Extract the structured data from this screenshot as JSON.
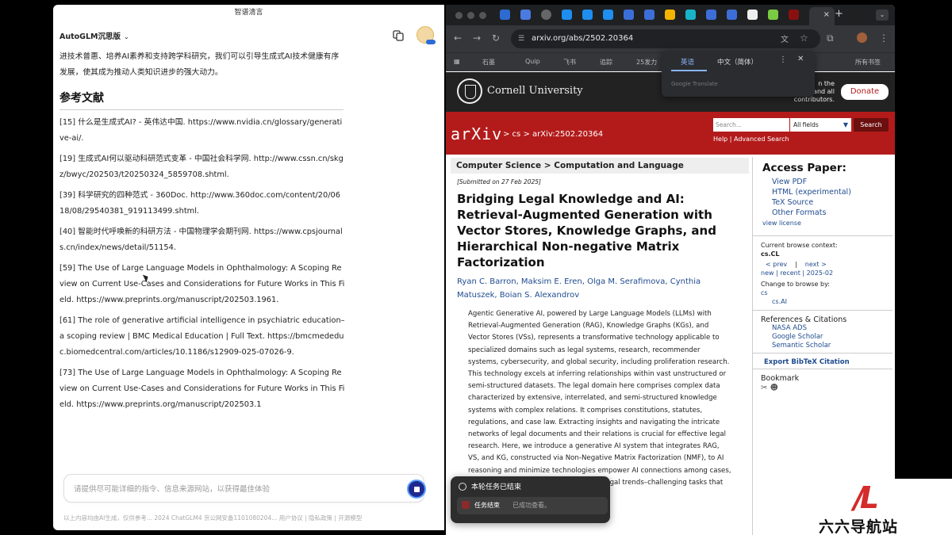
{
  "left": {
    "window_title": "智谱清言",
    "app_name": "AutoGLM沉思版",
    "intro_text": "进技术普惠、培养AI素养和支持跨学科研究，我们可以引导生成式AI技术健康有序发展，使其成为推动人类知识进步的强大动力。",
    "refs_heading": "参考文献",
    "refs": [
      "[15] 什么是生成式AI? - 英伟达中国. https://www.nvidia.cn/glossary/generative-ai/.",
      "[19] 生成式AI何以驱动科研范式变革 - 中国社会科学网. http://www.cssn.cn/skgz/bwyc/202503/t20250324_5859708.shtml.",
      "[39] 科学研究的四种范式 - 360Doc. http://www.360doc.com/content/20/0618/08/29540381_919113499.shtml.",
      "[40] 智能时代呼唤新的科研方法 - 中国物理学会期刊网. https://www.cpsjournals.cn/index/news/detail/51154.",
      "[59] The Use of Large Language Models in Ophthalmology: A Scoping Review on Current Use-Cases and Considerations for Future Works in This Field. https://www.preprints.org/manuscript/202503.1961.",
      "[61] The role of generative artificial intelligence in psychiatric education– a scoping review | BMC Medical Education | Full Text. https://bmcmededuc.biomedcentral.com/articles/10.1186/s12909-025-07026-9.",
      "[73] The Use of Large Language Models in Ophthalmology: A Scoping Review on Current Use-Cases and Considerations for Future Works in This Field. https://www.preprints.org/manuscript/202503.1"
    ],
    "input_placeholder": "请提供尽可能详细的指令、信息来源网站，以获得最佳体验",
    "footer": "以上内容均由AI生成，仅供参考...   2024 ChatGLM4 京公网安备1101080204...   用户协议 | 隐私政策 |   开源模型"
  },
  "browser": {
    "url": "arxiv.org/abs/2502.20364",
    "bookmarks": [
      "石墨",
      "Quip",
      "飞书",
      "追踪",
      "25发力",
      "所有书签"
    ],
    "translate": {
      "lang1": "英语",
      "lang2": "中文（简体）",
      "powered": "Google Translate"
    },
    "tab_close": "×",
    "tab_new": "+"
  },
  "page": {
    "cornell": "Cornell University",
    "thanks": "n the\nand all\ncontributors.",
    "donate": "Donate",
    "arxiv_logo": "arXiv",
    "breadcrumb": "> cs > arXiv:2502.20364",
    "search_placeholder": "Search...",
    "fields": "All fields",
    "search_btn": "Search",
    "help": "Help | Advanced Search",
    "subject": "Computer Science > Computation and Language",
    "submitted": "[Submitted on 27 Feb 2025]",
    "title": "Bridging Legal Knowledge and AI: Retrieval-Augmented Generation with Vector Stores, Knowledge Graphs, and Hierarchical Non-negative Matrix Factorization",
    "authors": "Ryan C. Barron, Maksim E. Eren, Olga M. Serafimova, Cynthia Matuszek, Boian S. Alexandrov",
    "abstract": "Agentic Generative AI, powered by Large Language Models (LLMs) with Retrieval-Augmented Generation (RAG), Knowledge Graphs (KGs), and Vector Stores (VSs), represents a transformative technology applicable to specialized domains such as legal systems, research, recommender systems, cybersecurity, and global security, including proliferation research. This technology excels at inferring relationships within vast unstructured or semi-structured datasets. The legal domain here comprises complex data characterized by extensive, interrelated, and semi-structured knowledge systems with complex relations. It comprises constitutions, statutes, regulations, and case law. Extracting insights and navigating the intricate networks of legal documents and their relations is crucial for effective legal research. Here, we introduce a generative AI system that integrates RAG, VS, and KG, constructed via Non-Negative Matrix Factorization (NMF), to                      AI reasoning and minimize                      technologies empower AI                      connections among cases,                      ing hidden relationships and predicting legal trends–challenging tasks that are essential for",
    "side": {
      "access_head": "Access Paper:",
      "access_links": [
        "View PDF",
        "HTML (experimental)",
        "TeX Source",
        "Other Formats"
      ],
      "license": "view license",
      "context_label": "Current browse context:",
      "context_value": "cs.CL",
      "prev": "< prev",
      "next": "next >",
      "nav2": "new | recent | 2025-02",
      "change": "Change to browse by:",
      "cs": "cs",
      "csai": "cs.AI",
      "refs_head": "References & Citations",
      "refs_links": [
        "NASA ADS",
        "Google Scholar",
        "Semantic Scholar"
      ],
      "bibtex": "Export BibTeX Citation",
      "bookmark": "Bookmark"
    }
  },
  "toast": {
    "title": "本轮任务已结束",
    "label": "任务结束",
    "message": "已成功查看。"
  },
  "watermark": {
    "text": "六六导航站",
    "mark": "/L"
  }
}
